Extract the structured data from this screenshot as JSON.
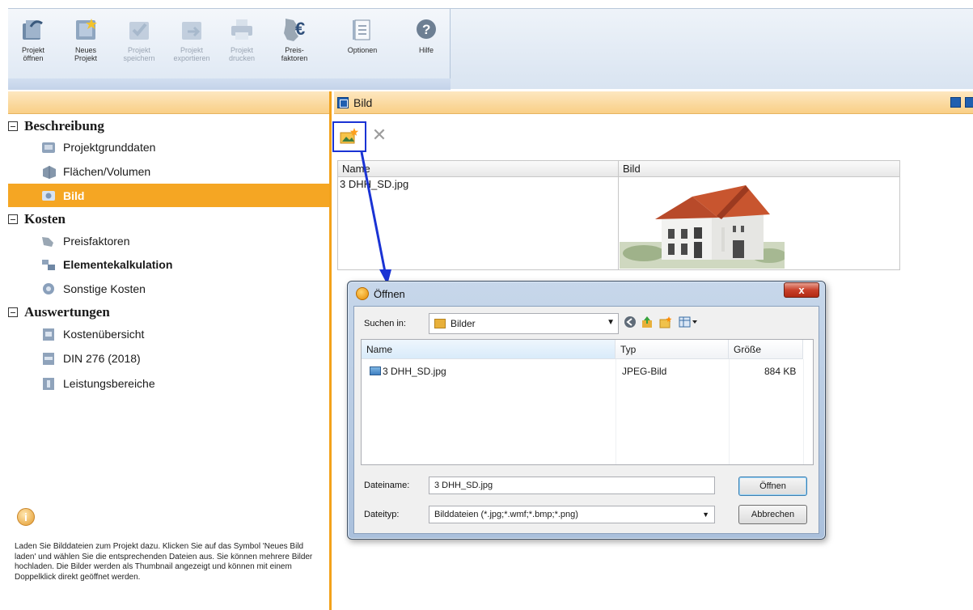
{
  "ribbon": {
    "buttons": [
      {
        "label": "Projekt\nöffnen",
        "icon": "open-project-icon",
        "enabled": true
      },
      {
        "label": "Neues\nProjekt",
        "icon": "new-project-icon",
        "enabled": true
      },
      {
        "label": "Projekt\nspeichern",
        "icon": "save-project-icon",
        "enabled": false
      },
      {
        "label": "Projekt\nexportieren",
        "icon": "export-project-icon",
        "enabled": false
      },
      {
        "label": "Projekt\ndrucken",
        "icon": "print-project-icon",
        "enabled": false
      },
      {
        "label": "Preis-\nfaktoren",
        "icon": "price-factors-icon",
        "enabled": true
      },
      {
        "label": "Optionen",
        "icon": "options-icon",
        "enabled": true
      },
      {
        "label": "Hilfe",
        "icon": "help-icon",
        "enabled": true
      }
    ]
  },
  "nav": {
    "groups": [
      {
        "title": "Beschreibung",
        "items": [
          {
            "label": "Projektgrunddaten",
            "icon": "project-data-icon"
          },
          {
            "label": "Flächen/Volumen",
            "icon": "area-volume-icon"
          },
          {
            "label": "Bild",
            "icon": "image-icon",
            "active": true
          }
        ]
      },
      {
        "title": "Kosten",
        "items": [
          {
            "label": "Preisfaktoren",
            "icon": "price-factors-icon"
          },
          {
            "label": "Elementekalkulation",
            "icon": "element-calc-icon",
            "bold": true
          },
          {
            "label": "Sonstige Kosten",
            "icon": "other-costs-icon"
          }
        ]
      },
      {
        "title": "Auswertungen",
        "items": [
          {
            "label": "Kostenübersicht",
            "icon": "cost-overview-icon"
          },
          {
            "label": "DIN 276 (2018)",
            "icon": "din-icon"
          },
          {
            "label": "Leistungsbereiche",
            "icon": "service-areas-icon"
          }
        ]
      }
    ],
    "info_text": "Laden Sie Bilddateien zum Projekt dazu. Klicken Sie auf das Symbol 'Neues Bild laden' und wählen Sie die entsprechenden Dateien aus. Sie können mehrere Bilder hochladen. Die Bilder werden als Thumbnail angezeigt und können mit einem Doppelklick direkt geöffnet werden."
  },
  "main": {
    "title": "Bild",
    "table": {
      "columns": [
        "Name",
        "Bild"
      ],
      "rows": [
        {
          "name": "3 DHH_SD.jpg"
        }
      ]
    }
  },
  "dialog": {
    "title": "Öffnen",
    "close_label": "x",
    "lookin_label": "Suchen in:",
    "lookin_value": "Bilder",
    "columns": [
      "Name",
      "Typ",
      "Größe"
    ],
    "files": [
      {
        "name": "3 DHH_SD.jpg",
        "type": "JPEG-Bild",
        "size": "884 KB"
      }
    ],
    "filename_label": "Dateiname:",
    "filename_value": "3 DHH_SD.jpg",
    "filetype_label": "Dateityp:",
    "filetype_value": "Bilddateien (*.jpg;*.wmf;*.bmp;*.png)",
    "open_label": "Öffnen",
    "cancel_label": "Abbrechen"
  },
  "colors": {
    "accent": "#f5a623",
    "highlight_frame": "#1a33d4",
    "header_gradient_top": "#fde7c0"
  }
}
